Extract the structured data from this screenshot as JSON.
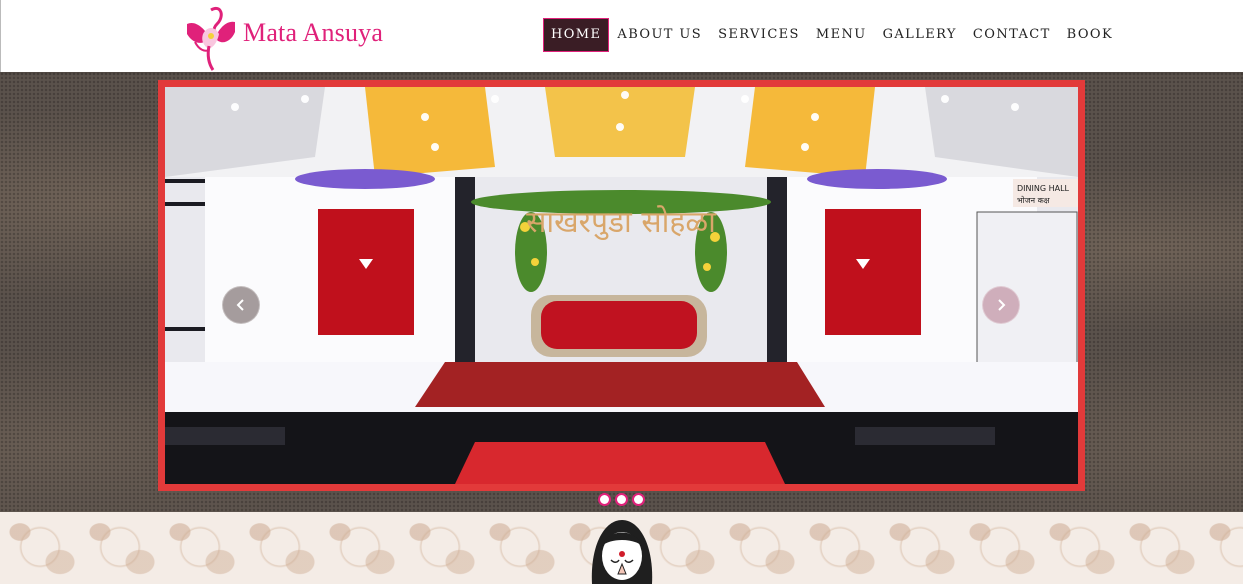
{
  "brand": {
    "name": "Mata Ansuya",
    "logo_icon": "lotus-figure-icon",
    "accent_color": "#e0217a"
  },
  "nav": {
    "items": [
      {
        "label": "HOME",
        "active": true
      },
      {
        "label": "ABOUT US",
        "active": false
      },
      {
        "label": "SERVICES",
        "active": false
      },
      {
        "label": "MENU",
        "active": false
      },
      {
        "label": "GALLERY",
        "active": false
      },
      {
        "label": "CONTACT",
        "active": false
      },
      {
        "label": "BOOK",
        "active": false
      }
    ]
  },
  "slider": {
    "current_slide": 1,
    "total_slides": 3,
    "frame_color": "#e23a3a",
    "prev_icon": "chevron-left-icon",
    "next_icon": "chevron-right-icon",
    "slide_image": {
      "stage_sign": "साखरपुडा सोहळा",
      "dining_sign_en": "DINING HALL",
      "dining_sign_hi": "भोजन कक्ष"
    }
  }
}
